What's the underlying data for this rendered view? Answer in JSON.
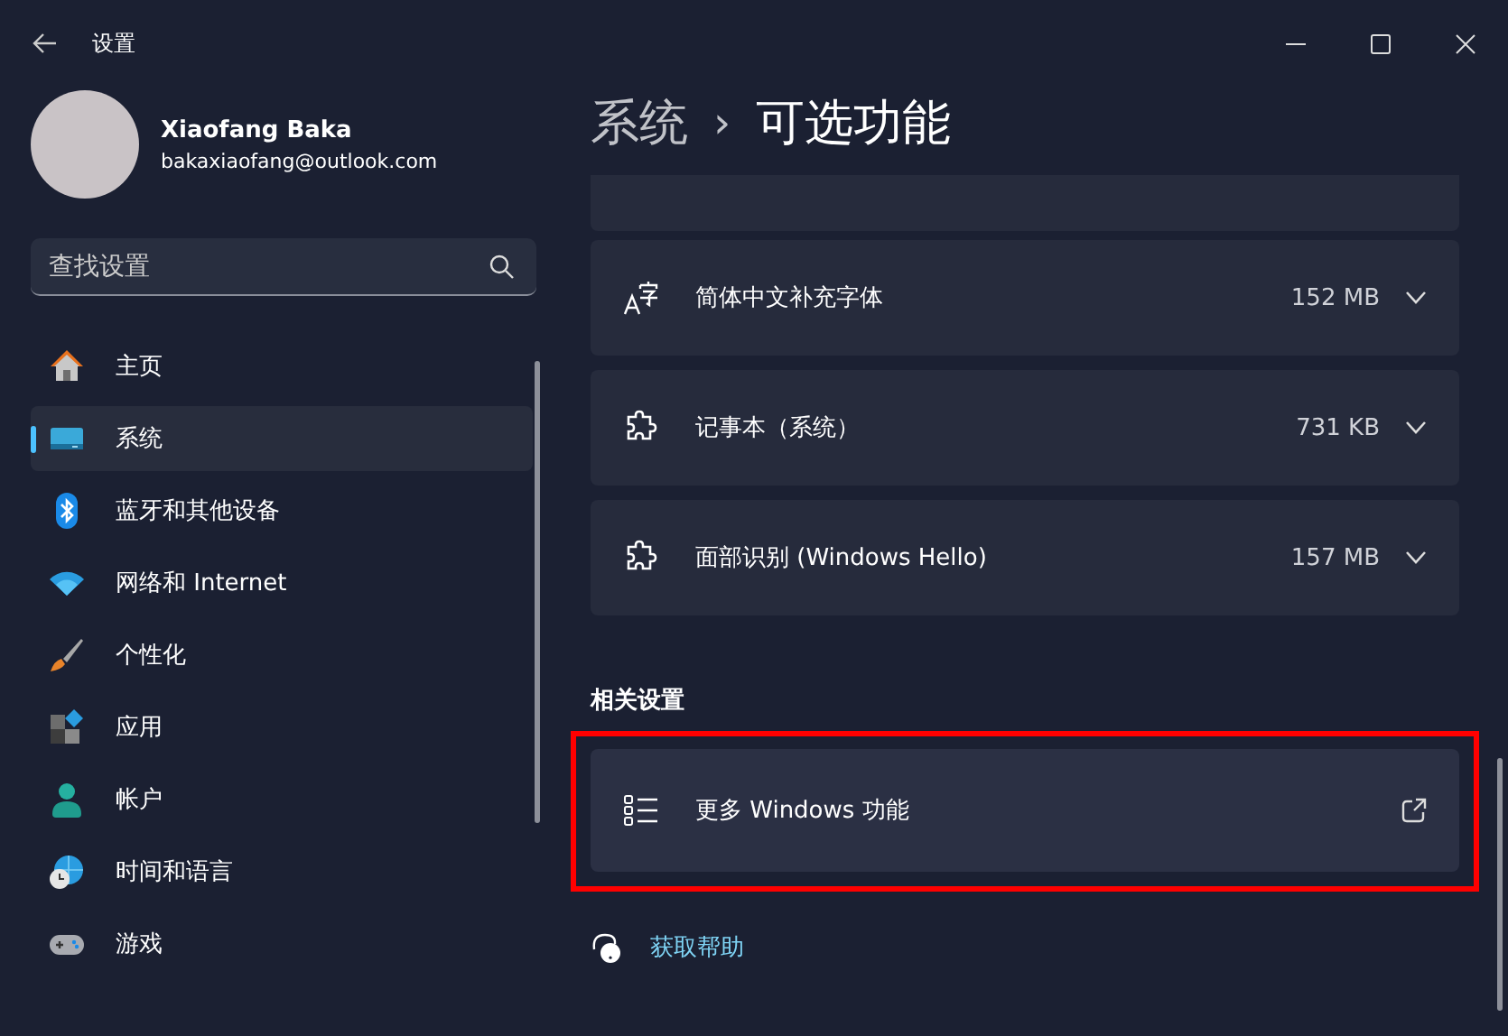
{
  "window": {
    "title": "设置"
  },
  "profile": {
    "name": "Xiaofang Baka",
    "email": "bakaxiaofang@outlook.com"
  },
  "search": {
    "placeholder": "查找设置"
  },
  "sidebar": {
    "items": [
      {
        "label": "主页",
        "selected": false
      },
      {
        "label": "系统",
        "selected": true
      },
      {
        "label": "蓝牙和其他设备",
        "selected": false
      },
      {
        "label": "网络和 Internet",
        "selected": false
      },
      {
        "label": "个性化",
        "selected": false
      },
      {
        "label": "应用",
        "selected": false
      },
      {
        "label": "帐户",
        "selected": false
      },
      {
        "label": "时间和语言",
        "selected": false
      },
      {
        "label": "游戏",
        "selected": false
      }
    ]
  },
  "breadcrumb": {
    "parent": "系统",
    "separator": "›",
    "current": "可选功能"
  },
  "features": [
    {
      "name": "简体中文补充字体",
      "size": "152 MB",
      "kind": "font",
      "expanded": false
    },
    {
      "name": "记事本（系统）",
      "size": "731 KB",
      "kind": "addon",
      "expanded": false
    },
    {
      "name": "面部识别 (Windows Hello)",
      "size": "157 MB",
      "kind": "addon",
      "expanded": false
    }
  ],
  "related": {
    "heading": "相关设置",
    "items": [
      {
        "label": "更多 Windows 功能",
        "highlighted": true
      }
    ]
  },
  "help": {
    "label": "获取帮助"
  }
}
